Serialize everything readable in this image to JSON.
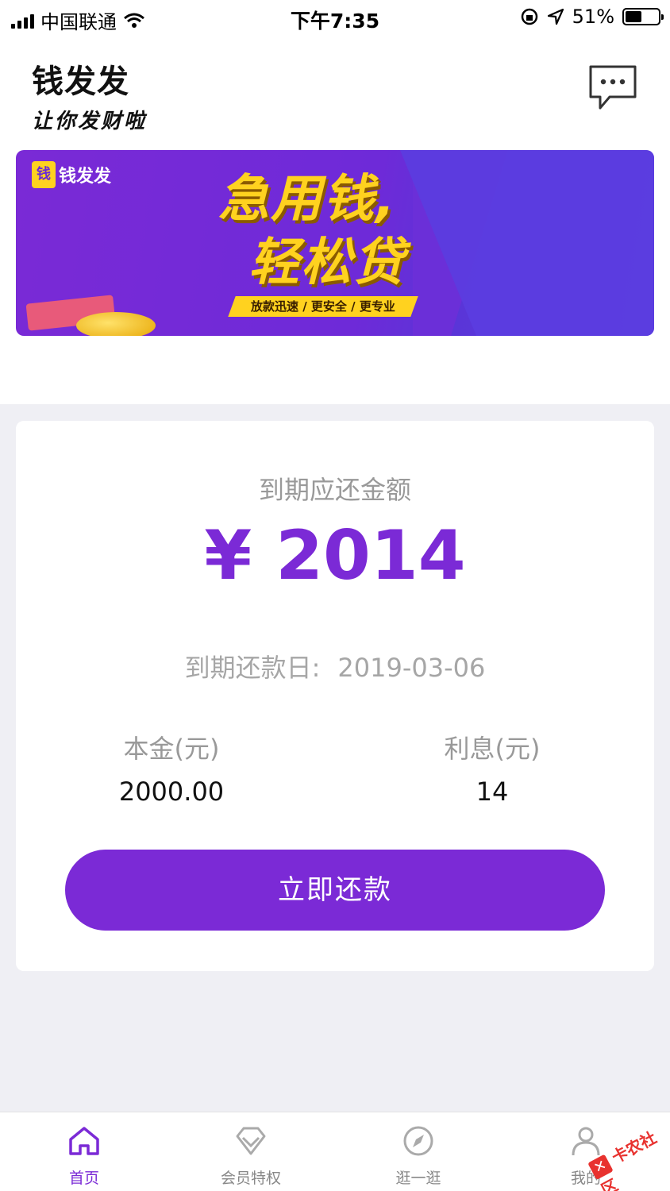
{
  "status_bar": {
    "carrier": "中国联通",
    "time": "下午7:35",
    "battery": "51%",
    "battery_level": 0.51
  },
  "header": {
    "brand_name": "钱发发",
    "slogan": "让你发财啦"
  },
  "banner": {
    "logo_text": "钱发发",
    "logo_mark": "钱",
    "title_line1": "急用钱,",
    "title_line2": "轻松贷",
    "tagline": "放款迅速 / 更安全 / 更专业"
  },
  "repayment": {
    "due_label": "到期应还金额",
    "due_amount": "¥ 2014",
    "due_date_label": "到期还款日:",
    "due_date": "2019-03-06",
    "principal_label": "本金(元)",
    "principal_value": "2000.00",
    "interest_label": "利息(元)",
    "interest_value": "14",
    "pay_button": "立即还款"
  },
  "tabbar": {
    "tabs": [
      {
        "label": "首页",
        "icon": "home-icon",
        "active": true
      },
      {
        "label": "会员特权",
        "icon": "diamond-icon",
        "active": false
      },
      {
        "label": "逛一逛",
        "icon": "compass-icon",
        "active": false
      },
      {
        "label": "我的",
        "icon": "user-icon",
        "active": false
      }
    ]
  },
  "watermark": {
    "text": "卡农社区"
  },
  "colors": {
    "accent": "#7b2ad6",
    "banner_yellow": "#ffd21f",
    "muted_text": "#999999"
  }
}
